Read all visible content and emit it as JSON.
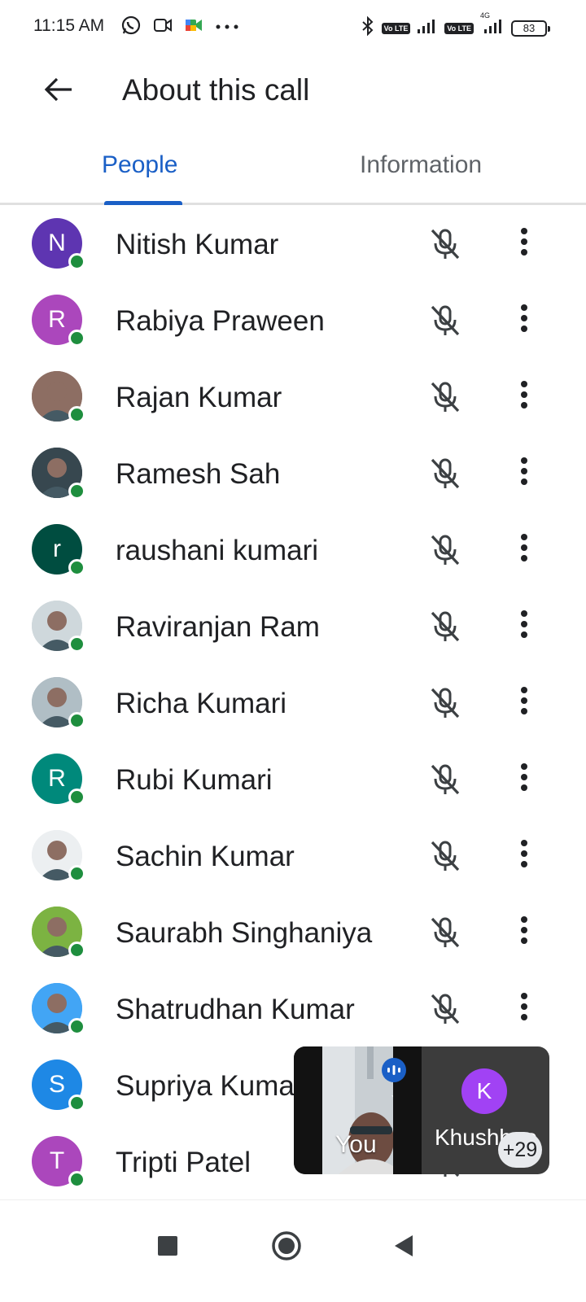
{
  "status_bar": {
    "time": "11:15 AM",
    "battery": "83",
    "network_label": "4G",
    "lte_badge": "Vo LTE",
    "left_icons": [
      "whatsapp-icon",
      "video-camera-icon",
      "meet-icon",
      "more-dots-icon"
    ],
    "right_icons": [
      "bluetooth-icon",
      "signal-icon",
      "signal-4g-icon",
      "battery-icon"
    ]
  },
  "app_bar": {
    "title": "About this call",
    "back_icon": "arrow-back-icon"
  },
  "tabs": [
    {
      "label": "People",
      "active": true
    },
    {
      "label": "Information",
      "active": false
    }
  ],
  "colors": {
    "accent": "#1a5fc6",
    "online": "#1e8e3e",
    "text": "#202124",
    "muted_text": "#5f6368"
  },
  "participants": [
    {
      "name": "Nitish Kumar",
      "initial": "N",
      "avatar_color": "#5e35b1",
      "photo": false,
      "muted": true
    },
    {
      "name": "Rabiya Praween",
      "initial": "R",
      "avatar_color": "#ab47bc",
      "photo": false,
      "muted": true
    },
    {
      "name": "Rajan Kumar",
      "initial": "",
      "avatar_color": "#8d6e63",
      "photo": true,
      "muted": true
    },
    {
      "name": "Ramesh Sah",
      "initial": "",
      "avatar_color": "#37474f",
      "photo": true,
      "muted": true
    },
    {
      "name": "raushani kumari",
      "initial": "r",
      "avatar_color": "#004d40",
      "photo": false,
      "muted": true
    },
    {
      "name": "Raviranjan Ram",
      "initial": "",
      "avatar_color": "#cfd8dc",
      "photo": true,
      "muted": true
    },
    {
      "name": "Richa Kumari",
      "initial": "",
      "avatar_color": "#b0bec5",
      "photo": true,
      "muted": true
    },
    {
      "name": "Rubi Kumari",
      "initial": "R",
      "avatar_color": "#00897b",
      "photo": false,
      "muted": true
    },
    {
      "name": "Sachin Kumar",
      "initial": "",
      "avatar_color": "#eceff1",
      "photo": true,
      "muted": true
    },
    {
      "name": "Saurabh Singhaniya",
      "initial": "",
      "avatar_color": "#7cb342",
      "photo": true,
      "muted": true
    },
    {
      "name": "Shatrudhan Kumar",
      "initial": "",
      "avatar_color": "#42a5f5",
      "photo": true,
      "muted": true
    },
    {
      "name": "Supriya Kumari",
      "initial": "S",
      "avatar_color": "#1e88e5",
      "photo": false,
      "muted": true
    },
    {
      "name": "Tripti Patel",
      "initial": "T",
      "avatar_color": "#ab47bc",
      "photo": false,
      "muted": true
    }
  ],
  "self_view": {
    "you_label": "You",
    "other_initial": "K",
    "other_name": "Khushboo",
    "more_count": "+29"
  },
  "nav_bar": {
    "icons": [
      "recents-square-icon",
      "home-circle-icon",
      "back-triangle-icon"
    ]
  }
}
